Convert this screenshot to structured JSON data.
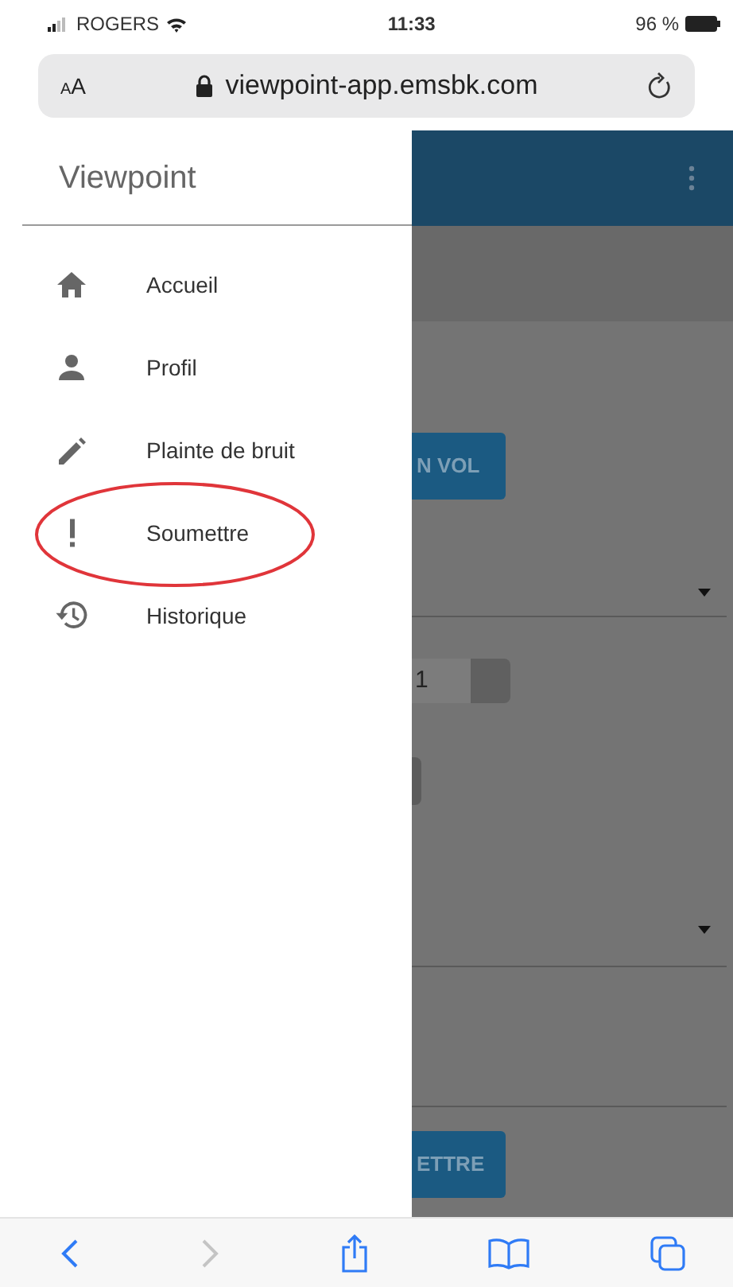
{
  "status_bar": {
    "carrier": "ROGERS",
    "time": "11:33",
    "battery": "96 %"
  },
  "browser": {
    "text_size_button": "AA",
    "url": "viewpoint-app.emsbk.com"
  },
  "drawer": {
    "title": "Viewpoint",
    "items": [
      {
        "label": "Accueil",
        "kind": "home",
        "circled": false
      },
      {
        "label": "Profil",
        "kind": "person",
        "circled": false
      },
      {
        "label": "Plainte de bruit",
        "kind": "pencil",
        "circled": false
      },
      {
        "label": "Soumettre",
        "kind": "exclamation",
        "circled": true
      },
      {
        "label": "Historique",
        "kind": "history",
        "circled": false
      }
    ]
  },
  "background_page": {
    "first_button": "N VOL",
    "select_value": "1",
    "last_button": "ETTRE"
  },
  "toolbar": {
    "forward_disabled": true
  }
}
